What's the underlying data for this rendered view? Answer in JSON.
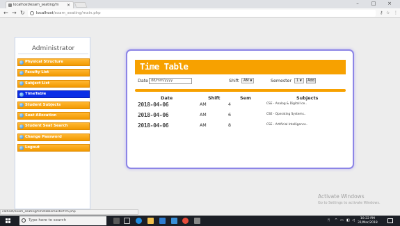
{
  "browser": {
    "tab_title": "localhost/exam_seating/m",
    "tab_close": "×",
    "window_controls": [
      "–",
      "□",
      "×"
    ],
    "url_host": "localhost",
    "url_path": "/exam_seating/main.php",
    "toolbar_icons": [
      "key-icon",
      "star-icon",
      "menu-icon"
    ]
  },
  "sidebar": {
    "title": "Administrator",
    "items": [
      {
        "label": "Physical Structure",
        "active": false
      },
      {
        "label": "Faculty List",
        "active": false
      },
      {
        "label": "Subject List",
        "active": false
      },
      {
        "label": "TimeTable",
        "active": true
      },
      {
        "label": "Student Subjects",
        "active": false
      },
      {
        "label": "Seat Allocation",
        "active": false
      },
      {
        "label": "Student Seat Search",
        "active": false
      },
      {
        "label": "Change Password",
        "active": false
      },
      {
        "label": "Logout",
        "active": false
      }
    ]
  },
  "timetable": {
    "title": "Time Table",
    "date_label": "Date",
    "date_placeholder": "dd/mm/yyyy",
    "shift_label": "Shift",
    "shift_value": "AM",
    "semester_label": "Semester",
    "semester_value": "1",
    "add_label": "Add",
    "columns": [
      "Date",
      "Shift",
      "Sem",
      "Subjects"
    ],
    "rows": [
      {
        "date": "2018-04-06",
        "shift": "AM",
        "sem": "4",
        "subjects": "CSE - Analog & Digital Ice.."
      },
      {
        "date": "2018-04-06",
        "shift": "AM",
        "sem": "6",
        "subjects": "CSE - Operating Systems.."
      },
      {
        "date": "2018-04-06",
        "shift": "AM",
        "sem": "8",
        "subjects": "CSE - Artificial Intelligence.."
      }
    ]
  },
  "status_url": "calhost/exam_seating/timetablemasterfrm.php",
  "watermark": {
    "title": "Activate Windows",
    "subtitle": "Go to Settings to activate Windows."
  },
  "taskbar": {
    "search_placeholder": "Type here to search",
    "time": "10:22 PM",
    "date": "31/Mar/2018"
  },
  "colors": {
    "accent_orange": "#f7a100",
    "active_blue": "#0b2ee6",
    "card_border": "#8c85e6"
  }
}
